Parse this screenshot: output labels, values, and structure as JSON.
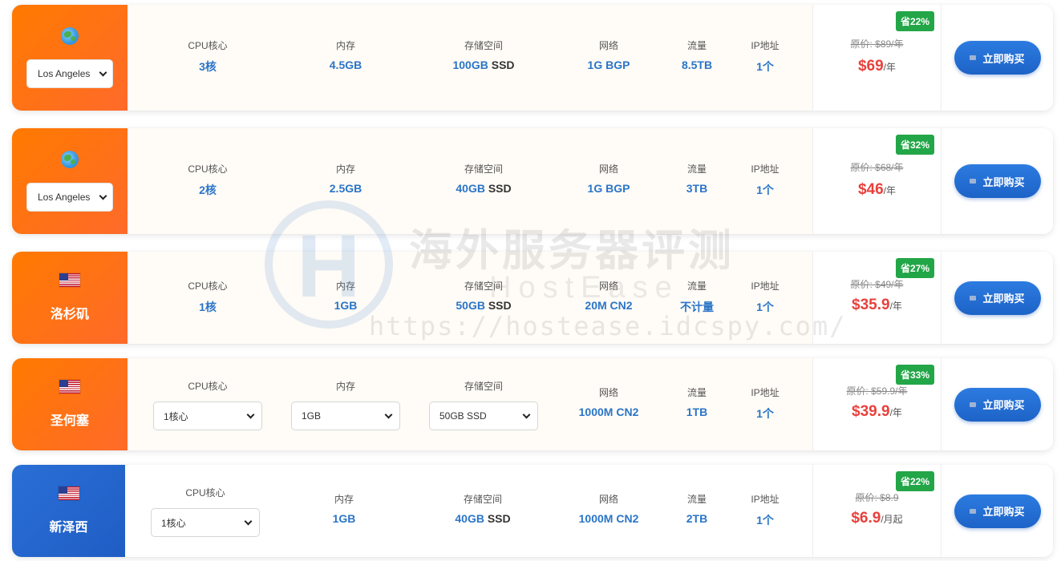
{
  "plans": [
    {
      "region": {
        "kind": "select",
        "icon": "globe-icon",
        "selected": "Los Angeles",
        "name": ""
      },
      "specs": {
        "cpu": {
          "label": "CPU核心",
          "value": "3核"
        },
        "mem": {
          "label": "内存",
          "value": "4.5GB"
        },
        "disk": {
          "label": "存储空间",
          "value": "100GB",
          "suffix": "SSD"
        },
        "net": {
          "label": "网络",
          "value": "1G BGP"
        },
        "traffic": {
          "label": "流量",
          "value": "8.5TB"
        },
        "ip": {
          "label": "IP地址",
          "value": "1个"
        }
      },
      "price": {
        "badge": "省22%",
        "original": "原价: $89/年",
        "current": "$69",
        "unit": "/年"
      },
      "buy_label": "立即购买"
    },
    {
      "region": {
        "kind": "select",
        "icon": "globe-icon",
        "selected": "Los Angeles",
        "name": ""
      },
      "specs": {
        "cpu": {
          "label": "CPU核心",
          "value": "2核"
        },
        "mem": {
          "label": "内存",
          "value": "2.5GB"
        },
        "disk": {
          "label": "存储空间",
          "value": "40GB",
          "suffix": "SSD"
        },
        "net": {
          "label": "网络",
          "value": "1G BGP"
        },
        "traffic": {
          "label": "流量",
          "value": "3TB"
        },
        "ip": {
          "label": "IP地址",
          "value": "1个"
        }
      },
      "price": {
        "badge": "省32%",
        "original": "原价: $68/年",
        "current": "$46",
        "unit": "/年"
      },
      "buy_label": "立即购买"
    },
    {
      "region": {
        "kind": "name",
        "icon": "us-flag-icon",
        "name": "洛杉矶"
      },
      "specs": {
        "cpu": {
          "label": "CPU核心",
          "value": "1核"
        },
        "mem": {
          "label": "内存",
          "value": "1GB"
        },
        "disk": {
          "label": "存储空间",
          "value": "50GB",
          "suffix": "SSD"
        },
        "net": {
          "label": "网络",
          "value": "20M CN2"
        },
        "traffic": {
          "label": "流量",
          "value": "不计量"
        },
        "ip": {
          "label": "IP地址",
          "value": "1个"
        }
      },
      "price": {
        "badge": "省27%",
        "original": "原价: $49/年",
        "current": "$35.9",
        "unit": "/年"
      },
      "buy_label": "立即购买"
    },
    {
      "region": {
        "kind": "name",
        "icon": "us-flag-icon",
        "name": "圣何塞"
      },
      "specs": {
        "cpu": {
          "label": "CPU核心",
          "select": "1核心"
        },
        "mem": {
          "label": "内存",
          "select": "1GB"
        },
        "disk": {
          "label": "存储空间",
          "select": "50GB SSD"
        },
        "net": {
          "label": "网络",
          "value": "1000M CN2"
        },
        "traffic": {
          "label": "流量",
          "value": "1TB"
        },
        "ip": {
          "label": "IP地址",
          "value": "1个"
        }
      },
      "price": {
        "badge": "省33%",
        "original": "原价: $59.9/年",
        "current": "$39.9",
        "unit": "/年"
      },
      "buy_label": "立即购买"
    },
    {
      "region": {
        "kind": "name",
        "icon": "us-flag-icon",
        "name": "新泽西"
      },
      "specs": {
        "cpu": {
          "label": "CPU核心",
          "select": "1核心"
        },
        "mem": {
          "label": "内存",
          "value": "1GB"
        },
        "disk": {
          "label": "存储空间",
          "value": "40GB",
          "suffix": "SSD"
        },
        "net": {
          "label": "网络",
          "value": "1000M CN2"
        },
        "traffic": {
          "label": "流量",
          "value": "2TB"
        },
        "ip": {
          "label": "IP地址",
          "value": "1个"
        }
      },
      "price": {
        "badge": "省22%",
        "original": "原价: $8.9",
        "current": "$6.9",
        "unit": "/月起"
      },
      "buy_label": "立即购买"
    }
  ],
  "watermark": {
    "title": "海外服务器评测",
    "brand": "HostEase",
    "url": "https://hostease.idcspy.com/",
    "logo_letter": "H"
  },
  "colors": {
    "accent_orange": "#ff7a00",
    "accent_blue": "#1f5dc4",
    "price_red": "#e8413c",
    "spec_blue": "#2a75c8",
    "badge_green": "#22a647"
  }
}
